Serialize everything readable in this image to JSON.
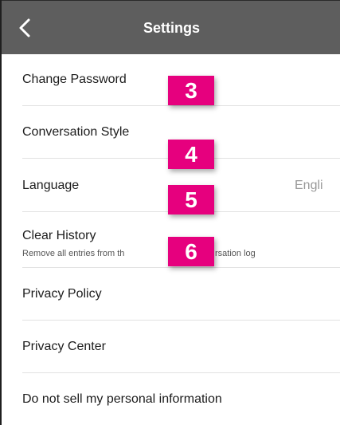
{
  "navbar": {
    "title": "Settings",
    "back_icon": "chevron-left-icon"
  },
  "settings": {
    "change_password": "Change Password",
    "conversation_style": "Conversation Style",
    "language": "Language",
    "language_value": "Engli",
    "clear_history": "Clear History",
    "clear_history_sub_left": "Remove all entries from th",
    "clear_history_sub_right": "rsation log",
    "privacy_policy": "Privacy Policy",
    "privacy_center": "Privacy Center",
    "do_not_sell": "Do not sell my personal information"
  },
  "badges": [
    "3",
    "4",
    "5",
    "6"
  ],
  "colors": {
    "navbar": "#5e5e5e",
    "badge": "#e6007e",
    "text": "#1c1c1c",
    "value": "#9a9a9a"
  }
}
